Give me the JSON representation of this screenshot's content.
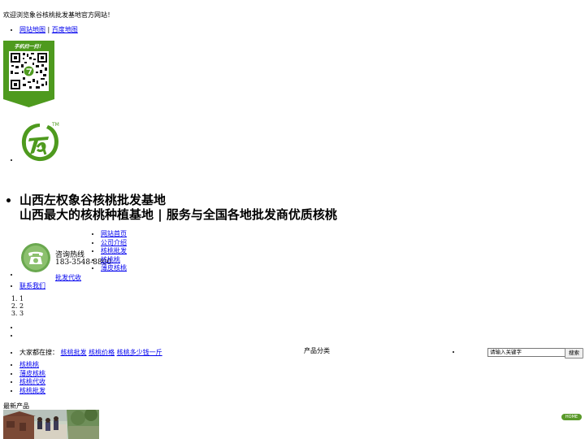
{
  "header": {
    "welcome": "欢迎浏览象谷核桃批发基地官方网站！",
    "links": [
      {
        "label": "网站地图"
      },
      {
        "label": "百度地图"
      }
    ],
    "link_separator": "|",
    "qr_caption": "手机扫一扫！",
    "logo_mark": "TM"
  },
  "site": {
    "title": "山西左权象谷核桃批发基地",
    "slogan": "山西最大的核桃种植基地 | 服务与全国各地批发商优质核桃"
  },
  "hotline": {
    "label": "咨询热线",
    "number": "183-3548-8800"
  },
  "nav": {
    "items": [
      {
        "label": "网站首页"
      },
      {
        "label": "公司介绍"
      },
      {
        "label": "核桃批发"
      },
      {
        "label": "核桃桃"
      },
      {
        "label": "薄皮核桃"
      }
    ],
    "agent": "批发代收",
    "contact": "联系我们"
  },
  "slider": {
    "numbers": [
      "1",
      "2",
      "3"
    ]
  },
  "hot_search": {
    "label": "大家都在搜：",
    "terms": [
      "核桃批发",
      "核桃价格",
      "核桃多少钱一斤"
    ]
  },
  "categories": {
    "title": "产品分类",
    "items": [
      "核桃桃",
      "薄皮核桃",
      "核桃代收",
      "核桃批发"
    ]
  },
  "search": {
    "placeholder": "请输入关键字",
    "button": "搜索"
  },
  "products": {
    "title": "最新产品"
  },
  "home_button": "HOME",
  "colors": {
    "brand_green": "#4e9a1e",
    "link": "#0000ee"
  }
}
